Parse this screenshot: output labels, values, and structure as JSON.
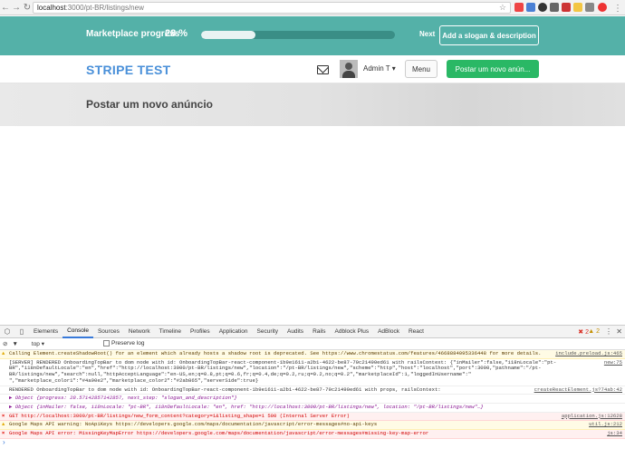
{
  "browser": {
    "url_host": "localhost",
    "url_path": ":3000/pt-BR/listings/new"
  },
  "topbar": {
    "progress_label": "Marketplace progress",
    "progress_percent": "28 %",
    "progress_value": 0.28,
    "next_label": "Next",
    "slogan_button": "Add a slogan & description"
  },
  "header": {
    "logo": "STRIPE TEST",
    "username": "Admin T",
    "menu_label": "Menu",
    "post_button": "Postar um novo anún..."
  },
  "hero": {
    "title": "Postar um novo anúncio"
  },
  "devtools": {
    "tabs": [
      "Elements",
      "Console",
      "Sources",
      "Network",
      "Timeline",
      "Profiles",
      "Application",
      "Security",
      "Audits",
      "Rails",
      "Adblock Plus",
      "AdBlock",
      "React"
    ],
    "error_count": "2",
    "warning_count": "2",
    "context": "top",
    "preserve_log": "Preserve log",
    "rows": [
      {
        "kind": "warn",
        "text": "Calling Element.createShadowRoot() for an element which already hosts a shadow root is deprecated. See https://www.chromestatus.com/features/4668884095336448 for more details.",
        "src": "include.preload.js:465"
      },
      {
        "kind": "log",
        "text": "[SERVER] RENDERED OnboardingTopBar to dom node with id: OnboardingTopBar-react-component-1b9e1611-a2b1-4622-be87-79c21490ed61 with railsContext: {\"inMailer\":false,\"i18nLocale\":\"pt-BR\",\"i18nDefaultLocale\":\"en\",\"href\":\"http://localhost:3000/pt-BR/listings/new\",\"location\":\"/pt-BR/listings/new\",\"scheme\":\"http\",\"host\":\"localhost\",\"port\":3000,\"pathname\":\"/pt-BR/listings/new\",\"search\":null,\"httpAcceptLanguage\":\"en-US,en;q=0.8,pt;q=0.6,fr;q=0.4,de;q=0.2,ru;q=0.2,no;q=0.2\",\"marketplaceId\":1,\"loggedInUsername\":\"         \",\"marketplace_color1\":\"#4a90e2\",\"marketplace_color2\":\"#2ab865\",\"serverSide\":true}",
        "src": "new:75"
      },
      {
        "kind": "log",
        "text": "RENDERED OnboardingTopBar to dom node with id: OnboardingTopBar-react-component-1b9e1611-a2b1-4622-be87-79c21490ed61 with props, railsContext:",
        "src": "createReactElement.js?74ab:42"
      },
      {
        "kind": "obj",
        "text": "▶ Object {progress: 28.57142857142857, next_step: \"slogan_and_description\"}",
        "src": ""
      },
      {
        "kind": "obj",
        "text": "▶ Object {inMailer: false, i18nLocale: \"pt-BR\", i18nDefaultLocale: \"en\", href: \"http://localhost:3000/pt-BR/listings/new\", location: \"/pt-BR/listings/new\"…}",
        "src": ""
      },
      {
        "kind": "err",
        "text": "GET http://localhost:3000/pt-BR/listings/new_form_content?category=1&listing_shape=1 500 (Internal Server Error)",
        "src": "application.js:12628"
      },
      {
        "kind": "warn",
        "text": "Google Maps API warning: NoApiKeys https://developers.google.com/maps/documentation/javascript/error-messages#no-api-keys",
        "src": "util.js:212"
      },
      {
        "kind": "err",
        "text": "Google Maps API error: MissingKeyMapError https://developers.google.com/maps/documentation/javascript/error-messages#missing-key-map-error",
        "src": "js:34"
      }
    ]
  }
}
